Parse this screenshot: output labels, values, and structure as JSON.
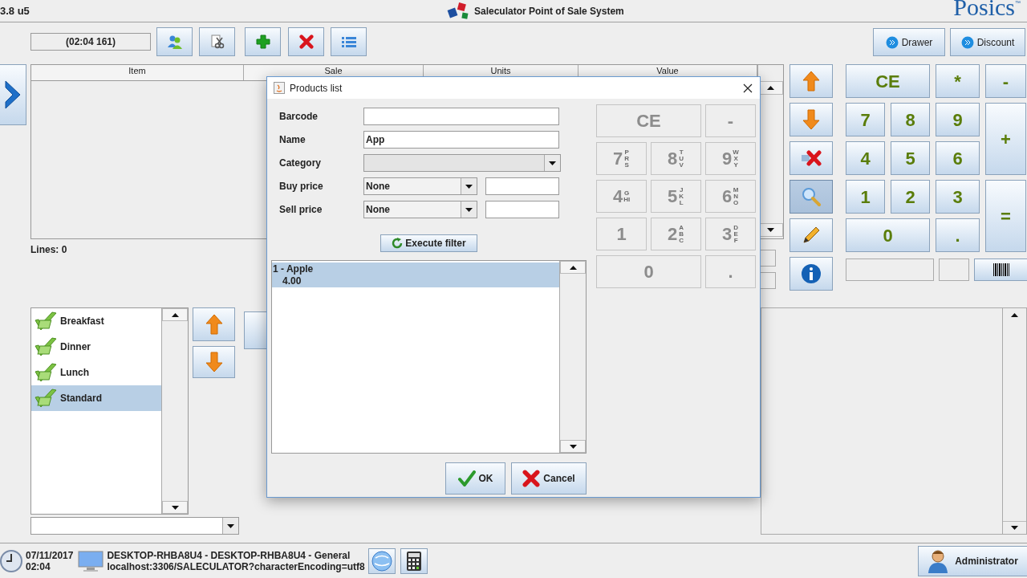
{
  "app_header": {
    "version": "3.8 u5",
    "title": "Saleculator Point of Sale System",
    "brand": "Posics",
    "brand_mark": "™"
  },
  "toolbar": {
    "ticket_id": "(02:04 161)",
    "buttons": [
      {
        "kind": "customers"
      },
      {
        "kind": "split"
      },
      {
        "kind": "add"
      },
      {
        "kind": "delete"
      },
      {
        "kind": "list"
      }
    ]
  },
  "header_buttons": [
    "Drawer",
    "Discount"
  ],
  "ticket_table": {
    "columns": [
      "Item",
      "Sale",
      "Units",
      "Value"
    ],
    "lines": "Lines: 0"
  },
  "side_tools": [
    {
      "kind": "up",
      "selected": false
    },
    {
      "kind": "down",
      "selected": false
    },
    {
      "kind": "remove",
      "selected": false
    },
    {
      "kind": "search",
      "selected": true
    },
    {
      "kind": "edit",
      "selected": false
    },
    {
      "kind": "info",
      "selected": false
    }
  ],
  "keypad": {
    "disabled": false,
    "keys": [
      "CE",
      "*",
      "-",
      "7",
      "8",
      "9",
      "+",
      "4",
      "5",
      "6",
      "1",
      "2",
      "3",
      "=",
      "0",
      "."
    ]
  },
  "categories": [
    {
      "label": "Breakfast",
      "selected": false
    },
    {
      "label": "Dinner",
      "selected": false
    },
    {
      "label": "Lunch",
      "selected": false
    },
    {
      "label": "Standard",
      "selected": true
    }
  ],
  "dialog": {
    "title": "Products list",
    "fields": [
      {
        "label": "Barcode",
        "kind": "text"
      },
      {
        "label": "Name",
        "kind": "text",
        "value": "App"
      },
      {
        "label": "Category",
        "kind": "combo",
        "disabled": true
      },
      {
        "label": "Buy price",
        "kind": "combo_text",
        "value": "None"
      },
      {
        "label": "Sell price",
        "kind": "combo_text",
        "value": "None"
      }
    ],
    "filter_button": "Execute filter",
    "results": [
      {
        "name": "1 - Apple",
        "price": "4.00",
        "selected": true
      }
    ],
    "keypad": {
      "disabled": true,
      "keys": [
        {
          "label": "CE"
        },
        {
          "label": "-"
        },
        {
          "label": "7",
          "letters": "PRS"
        },
        {
          "label": "8",
          "letters": "TUV"
        },
        {
          "label": "9",
          "letters": "WXY"
        },
        {
          "label": "4",
          "letters": "GHI"
        },
        {
          "label": "5",
          "letters": "JKL"
        },
        {
          "label": "6",
          "letters": "MNO"
        },
        {
          "label": "1"
        },
        {
          "label": "2",
          "letters": "ABC"
        },
        {
          "label": "3",
          "letters": "DEF"
        },
        {
          "label": "0"
        },
        {
          "label": "."
        }
      ]
    },
    "buttons": [
      {
        "kind": "ok",
        "label": "OK"
      },
      {
        "kind": "cancel",
        "label": "Cancel"
      }
    ]
  },
  "status_bar": {
    "date": "07/11/2017",
    "time": "02:04",
    "host": "DESKTOP-RHBA8U4 - DESKTOP-RHBA8U4 - General",
    "url": "localhost:3306/SALECULATOR?characterEncoding=utf8",
    "user": "Administrator"
  }
}
